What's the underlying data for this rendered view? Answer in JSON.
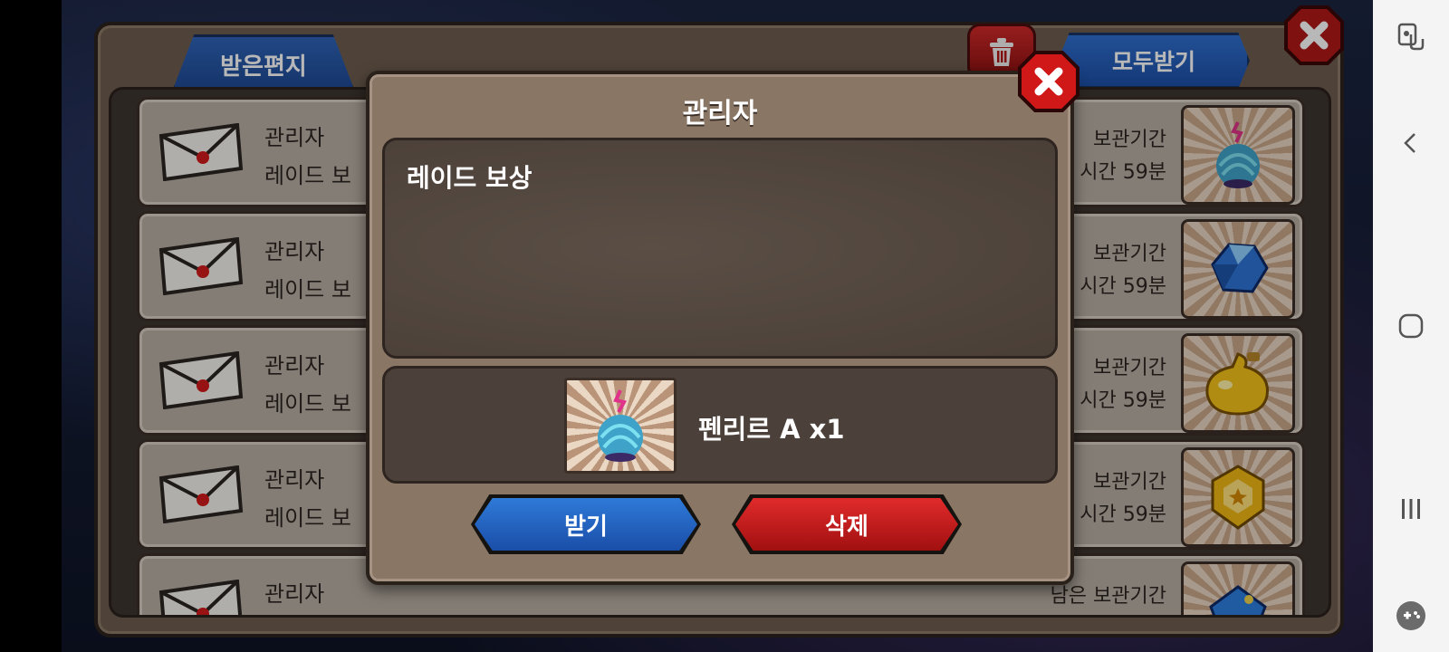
{
  "header": {
    "tab_received": "받은편지",
    "receive_all": "모두받기"
  },
  "mail_rows": [
    {
      "sender": "관리자",
      "title": "레이드 보",
      "keep_label": "보관기간",
      "keep_time": "시간 59분",
      "item": "egg-icon"
    },
    {
      "sender": "관리자",
      "title": "레이드 보",
      "keep_label": "보관기간",
      "keep_time": "시간 59분",
      "item": "crystal-icon"
    },
    {
      "sender": "관리자",
      "title": "레이드 보",
      "keep_label": "보관기간",
      "keep_time": "시간 59분",
      "item": "potion-icon"
    },
    {
      "sender": "관리자",
      "title": "레이드 보",
      "keep_label": "보관기간",
      "keep_time": "시간 59분",
      "item": "gold-gem-icon"
    },
    {
      "sender": "관리자",
      "title": "",
      "keep_label": "남은 보관기간",
      "keep_time": "",
      "item": "blue-stone-icon"
    }
  ],
  "dialog": {
    "title": "관리자",
    "message": "레이드 보상",
    "reward_label": "펜리르 A x1",
    "receive_label": "받기",
    "delete_label": "삭제"
  },
  "colors": {
    "accent_blue": "#2f6fd0",
    "accent_red": "#d12a2a",
    "panel": "#8a7665"
  }
}
